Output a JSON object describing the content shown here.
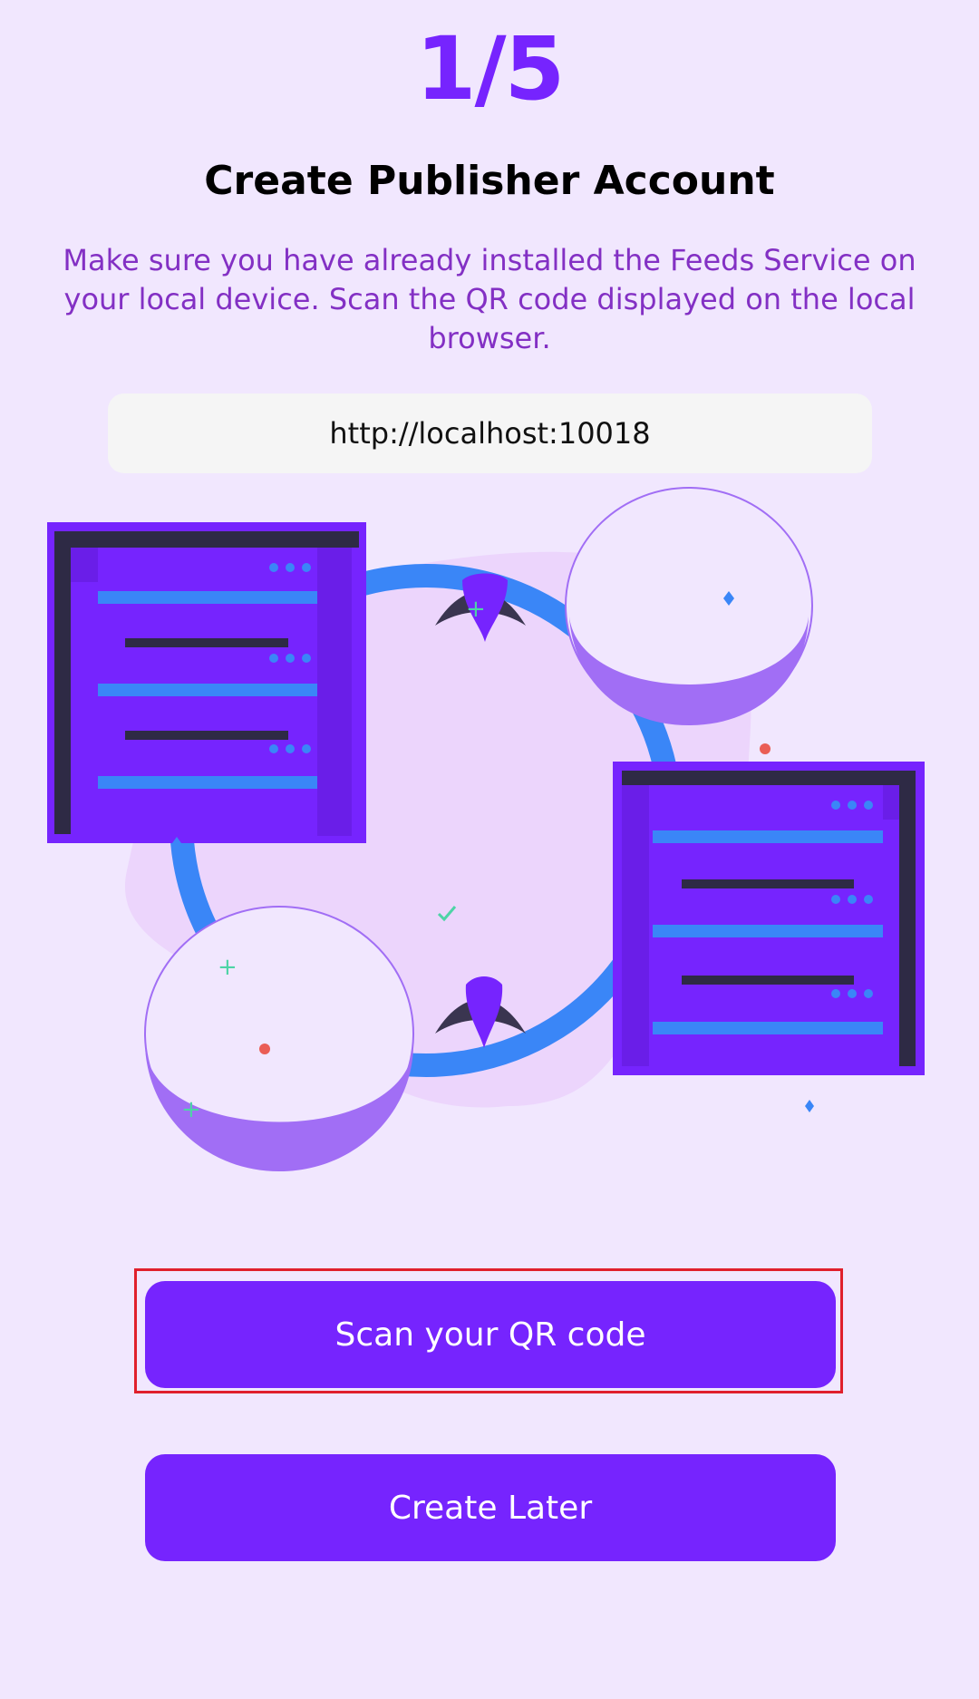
{
  "step_indicator": "1/5",
  "title": "Create Publisher Account",
  "description": "Make sure you have already installed the Feeds Service on your local device. Scan the QR code displayed on the local browser.",
  "url": "http://localhost:10018",
  "buttons": {
    "scan_label": "Scan your QR code",
    "later_label": "Create Later"
  },
  "colors": {
    "accent": "#7624fe",
    "background": "#f1e7fe",
    "description_text": "#8330c4",
    "highlight_border": "#e0202c"
  }
}
